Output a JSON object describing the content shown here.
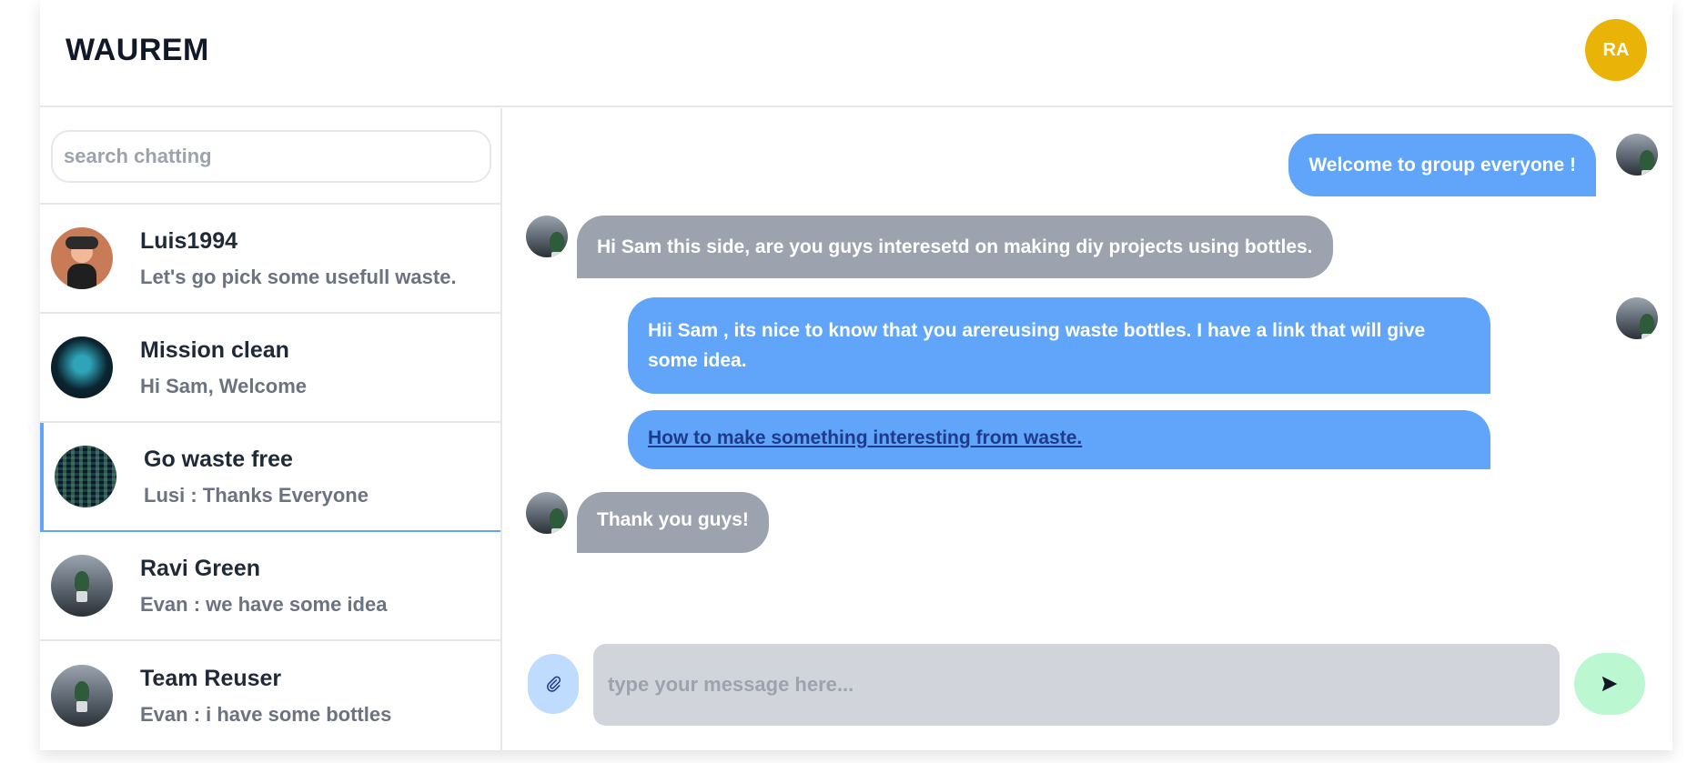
{
  "header": {
    "logo": "WAUREM",
    "user_initials": "RA",
    "avatar_color": "#eab308"
  },
  "search": {
    "placeholder": "search chatting"
  },
  "chats": [
    {
      "name": "Luis1994",
      "preview": "Let's go pick some usefull waste.",
      "avatar": "person-photo"
    },
    {
      "name": "Mission clean",
      "preview": "Hi Sam, Welcome",
      "avatar": "logo-photo"
    },
    {
      "name": "Go waste free",
      "preview": "Lusi : Thanks Everyone",
      "avatar": "code-photo",
      "active": true
    },
    {
      "name": "Ravi Green",
      "preview": "Evan : we have some idea",
      "avatar": "plant-photo"
    },
    {
      "name": "Team Reuser",
      "preview": "Evan : i have some bottles",
      "avatar": "plant-photo"
    }
  ],
  "messages": [
    {
      "side": "sent",
      "text": "Welcome to group everyone !"
    },
    {
      "side": "received",
      "text": "Hi Sam this side, are you guys interesetd on making diy projects using bottles."
    },
    {
      "side": "sent",
      "text": "Hii Sam , its nice to know that you arereusing waste bottles. I have a link that will give some idea."
    },
    {
      "side": "sent",
      "link_text": "How to make something interesting from waste."
    },
    {
      "side": "received",
      "text": "Thank you guys!"
    }
  ],
  "composer": {
    "placeholder": "type your message here...",
    "attach_icon": "paperclip-icon",
    "send_icon": "send-icon"
  },
  "colors": {
    "accent": "#60a5fa",
    "received": "#9ca3af",
    "send_button": "#bbf7d0",
    "attach_button": "#bfdbfe"
  }
}
